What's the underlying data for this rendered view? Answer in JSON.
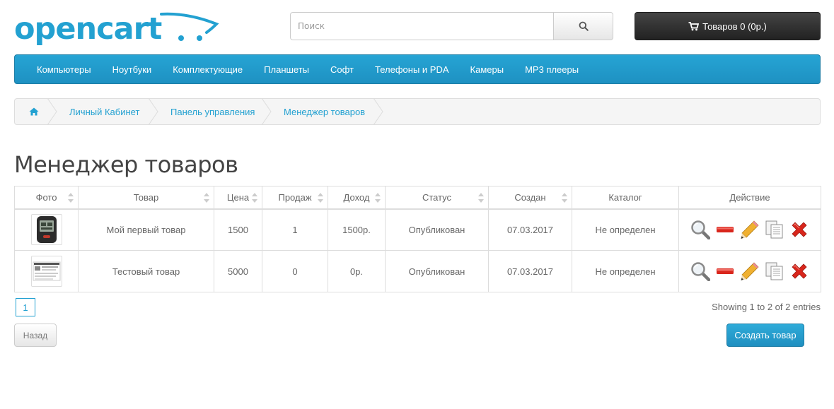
{
  "header": {
    "logo_text": "opencart",
    "search": {
      "placeholder": "Поиск"
    },
    "cart_label": "Товаров 0 (0р.)"
  },
  "menu": {
    "items": [
      "Компьютеры",
      "Ноутбуки",
      "Комплектующие",
      "Планшеты",
      "Софт",
      "Телефоны и PDA",
      "Камеры",
      "MP3 плееры"
    ]
  },
  "breadcrumb": {
    "items": [
      "Личный Кабинет",
      "Панель управления",
      "Менеджер товаров"
    ]
  },
  "page_title": "Менеджер товаров",
  "table": {
    "columns": [
      "Фото",
      "Товар",
      "Цена",
      "Продаж",
      "Доход",
      "Статус",
      "Создан",
      "Каталог",
      "Действие"
    ],
    "rows": [
      {
        "product": "Мой первый товар",
        "price": "1500",
        "sales": "1",
        "income": "1500р.",
        "status": "Опубликован",
        "created": "07.03.2017",
        "catalog": "Не определен"
      },
      {
        "product": "Тестовый товар",
        "price": "5000",
        "sales": "0",
        "income": "0р.",
        "status": "Опубликован",
        "created": "07.03.2017",
        "catalog": "Не определен"
      }
    ]
  },
  "pagination": {
    "current_page": "1",
    "showing": "Showing 1 to 2 of 2 entries"
  },
  "buttons": {
    "back": "Назад",
    "create": "Создать товар"
  },
  "colors": {
    "accent": "#23a1d1",
    "menu_bg": "#1e91c2",
    "cart_bg": "#2b2b2b",
    "status_published": "#3c8f2f",
    "delete_red": "#d9261c"
  }
}
